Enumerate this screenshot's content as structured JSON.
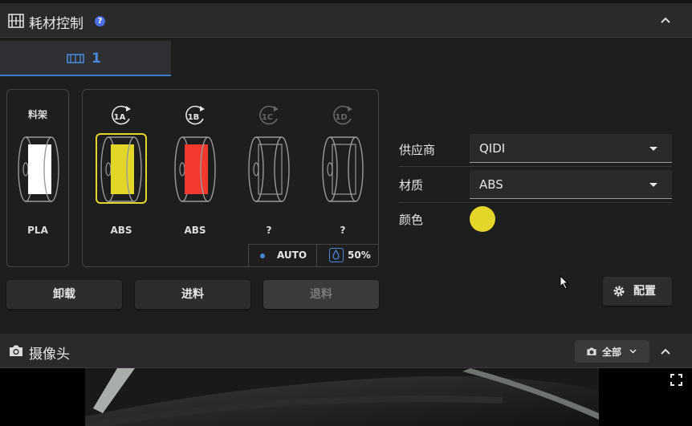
{
  "filament_panel": {
    "title": "耗材控制",
    "tab_label": "1",
    "external_spool": {
      "header": "料架",
      "material": "PLA",
      "color": "#ffffff"
    },
    "slots": [
      {
        "id": "1A",
        "material": "ABS",
        "color": "#e3d628",
        "selected": true,
        "active": true
      },
      {
        "id": "1B",
        "material": "ABS",
        "color": "#f43a2f",
        "selected": false,
        "active": true
      },
      {
        "id": "1C",
        "material": "?",
        "color": "",
        "selected": false,
        "active": false
      },
      {
        "id": "1D",
        "material": "?",
        "color": "",
        "selected": false,
        "active": false
      }
    ],
    "mode_label": "AUTO",
    "humidity": "50%",
    "unload_label": "卸载",
    "load_label": "进料",
    "retract_label": "退料",
    "vendor_label": "供应商",
    "vendor_value": "QIDI",
    "material_label": "材质",
    "material_value": "ABS",
    "color_label": "颜色",
    "color_value": "#e3d628",
    "config_label": "配置"
  },
  "camera_panel": {
    "title": "摄像头",
    "filter_label": "全部"
  },
  "colors": {
    "accent": "#4a86d8",
    "selected_outline": "#e3d628"
  }
}
